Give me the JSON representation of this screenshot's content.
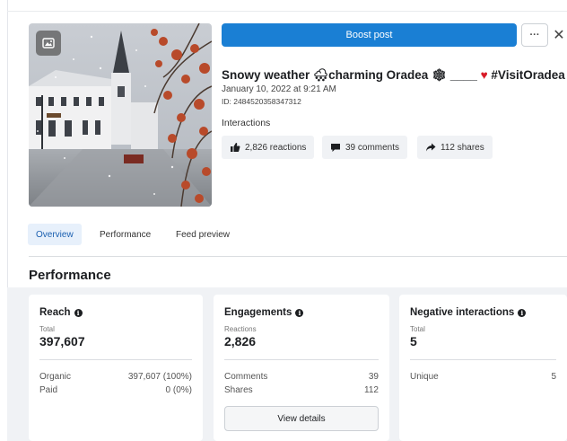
{
  "header": {
    "boost_label": "Boost post",
    "more_label": "···",
    "close_label": "✕"
  },
  "post": {
    "title_a": "Snowy weather ",
    "weather_icon": "🌨",
    "title_b": "charming Oradea ",
    "snow_icon": "❄",
    "title_c": " ____ ",
    "heart_icon": "♥",
    "title_d": " #VisitOradea ...",
    "date": "January 10, 2022 at 9:21 AM",
    "id": "ID: 2484520358347312",
    "interactions_label": "Interactions",
    "reactions": "2,826 reactions",
    "comments": "39 comments",
    "shares": "112 shares"
  },
  "tabs": [
    {
      "label": "Overview"
    },
    {
      "label": "Performance"
    },
    {
      "label": "Feed preview"
    }
  ],
  "performance_heading": "Performance",
  "cards": {
    "reach": {
      "title": "Reach",
      "sub": "Total",
      "value": "397,607",
      "rows": [
        {
          "label": "Organic",
          "value": "397,607 (100%)"
        },
        {
          "label": "Paid",
          "value": "0 (0%)"
        }
      ]
    },
    "engagements": {
      "title": "Engagements",
      "sub": "Reactions",
      "value": "2,826",
      "rows": [
        {
          "label": "Comments",
          "value": "39"
        },
        {
          "label": "Shares",
          "value": "112"
        }
      ],
      "button": "View details"
    },
    "negative": {
      "title": "Negative interactions",
      "sub": "Total",
      "value": "5",
      "rows": [
        {
          "label": "Unique",
          "value": "5"
        }
      ]
    }
  },
  "colors": {
    "accent": "#1a7fd4",
    "heart": "#d81b28"
  }
}
